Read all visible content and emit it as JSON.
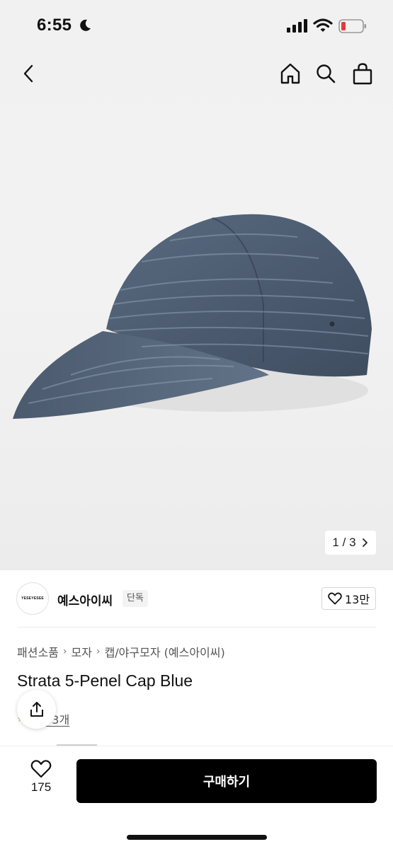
{
  "status_bar": {
    "time": "6:55"
  },
  "gallery": {
    "current": "1",
    "separator": "/",
    "total": "3"
  },
  "seller": {
    "logo_text": "YESEYESEE",
    "name": "예스아이씨",
    "badge": "단독",
    "likes": "13만"
  },
  "breadcrumb": {
    "items": [
      "패션소품",
      "모자",
      "캡/야구모자 (예스아이씨)"
    ]
  },
  "product": {
    "title": "Strata 5-Penel Cap Blue",
    "review_link": "후기 3개"
  },
  "bottom_bar": {
    "wish_count": "175",
    "buy_label": "구매하기"
  },
  "colors": {
    "buy_button": "#000000",
    "star": "#f5a623",
    "cap": "#4a5a6e"
  }
}
